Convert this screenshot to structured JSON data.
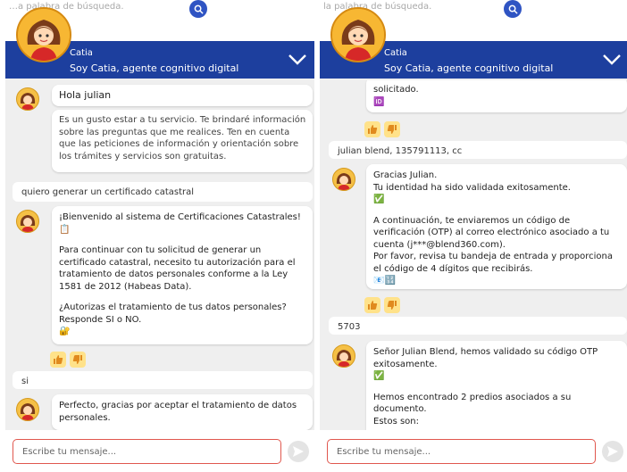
{
  "left": {
    "search_placeholder": "…a palabra de búsqueda.",
    "header": {
      "name": "Catia",
      "subtitle": "Soy Catia, agente cognitivo digital"
    },
    "messages": {
      "greeting": "Hola julian",
      "intro_lines": [
        "Es un gusto estar a tu servicio. Te brindaré información",
        "sobre las preguntas que me realices. Ten en cuenta",
        "que las peticiones de información y orientación sobre",
        "los trámites y servicios son gratuitas."
      ],
      "user_1": "quiero generar un certificado catastral",
      "welcome_lines": [
        "¡Bienvenido al sistema de Certificaciones Catastrales!",
        "📋"
      ],
      "consent_lines": [
        "Para continuar con tu solicitud de generar un",
        "certificado catastral, necesito tu autorización para el",
        "tratamiento de datos personales conforme a la Ley",
        "1581 de 2012 (Habeas Data)."
      ],
      "question_lines": [
        "¿Autorizas el tratamiento de tus datos personales?",
        "Responde SI o NO.",
        "🔐"
      ],
      "user_2": "si",
      "thanks_lines": [
        "Perfecto, gracias por aceptar el tratamiento de datos",
        "personales."
      ]
    },
    "input_placeholder": "Escribe tu mensaje..."
  },
  "right": {
    "search_placeholder": "la palabra de búsqueda.",
    "header": {
      "name": "Catia",
      "subtitle": "Soy Catia, agente cognitivo digital"
    },
    "messages": {
      "prev_lines": [
        "solicitado.",
        "🆔"
      ],
      "user_1": "julian blend, 135791113, cc",
      "validated_lines": [
        "Gracias Julian.",
        "Tu identidad ha sido validada exitosamente.",
        "✅"
      ],
      "otp_lines": [
        "A continuación, te enviaremos un código de",
        "verificación (OTP) al correo electrónico asociado a tu",
        "cuenta (j***@blend360.com).",
        "Por favor, revisa tu bandeja de entrada y proporciona",
        "el código de 4 dígitos que recibirás.",
        "📧🔢"
      ],
      "user_2": "5703",
      "otp_ok_lines": [
        "Señor Julian Blend, hemos validado su código OTP",
        "exitosamente.",
        "✅"
      ],
      "predios_lines": [
        "Hemos encontrado 2 predios asociados a su",
        "documento.",
        "Estos son:"
      ]
    },
    "input_placeholder": "Escribe tu mensaje..."
  },
  "colors": {
    "header_bg": "#1d3f9e",
    "chat_bg": "#efefef",
    "input_border": "#e0574e",
    "feedback_bg": "#ffe28a"
  },
  "icons": {
    "search": "search-icon",
    "collapse": "chevron-down-icon",
    "send": "send-icon",
    "like": "thumbs-up-icon",
    "dislike": "thumbs-down-icon"
  }
}
